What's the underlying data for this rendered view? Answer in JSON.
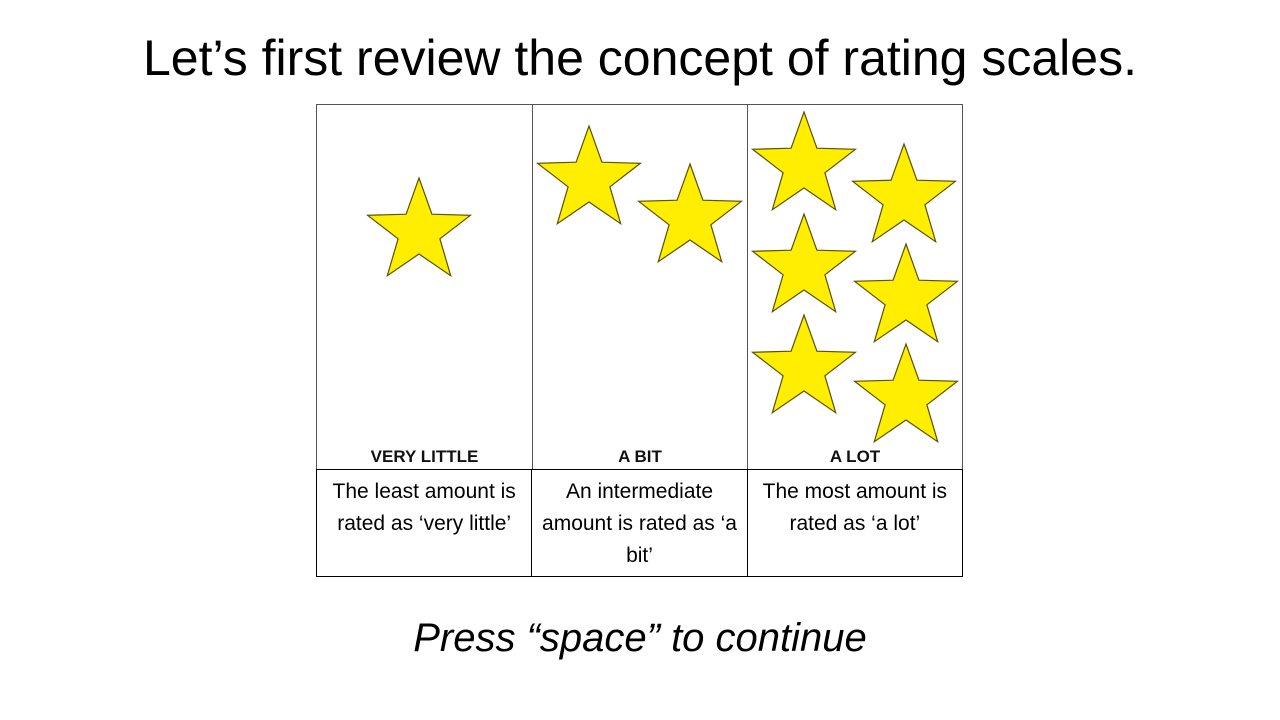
{
  "title": "Let’s first review the concept of rating scales.",
  "columns": [
    {
      "label": "VERY LITTLE",
      "description": "The least amount is rated as ‘very little’",
      "star_count": 1
    },
    {
      "label": "A BIT",
      "description": "An intermediate amount is rated as ‘a bit’",
      "star_count": 2
    },
    {
      "label": "A LOT",
      "description": "The most amount is rated as ‘a lot’",
      "star_count": 6
    }
  ],
  "star_color": "#ffee00",
  "star_outline_color": "#5a5200",
  "footer": {
    "continue_text": "Press “space” to continue"
  }
}
